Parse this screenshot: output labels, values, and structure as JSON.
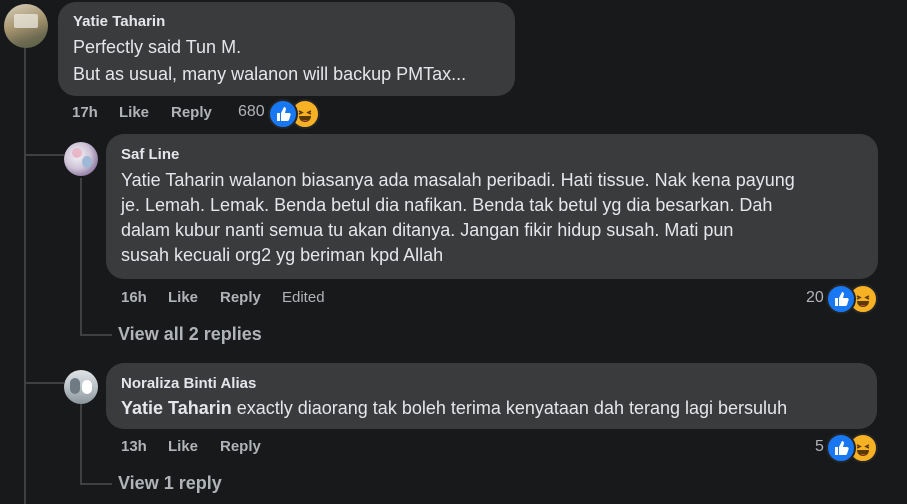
{
  "comments": [
    {
      "author": "Yatie Taharin",
      "lines": [
        "Perfectly said Tun M.",
        "But as usual, many walanon will backup PMTax..."
      ],
      "time": "17h",
      "like": "Like",
      "reply": "Reply",
      "reactions_count": "680",
      "reaction_icons": [
        "like-icon",
        "haha-icon"
      ]
    },
    {
      "author": "Saf Line",
      "lines": [
        "Yatie Taharin walanon biasanya ada masalah peribadi. Hati tissue. Nak kena payung",
        "je. Lemah. Lemak. Benda betul dia nafikan. Benda tak betul yg dia besarkan. Dah",
        "dalam kubur nanti semua tu akan ditanya. Jangan fikir hidup susah. Mati pun",
        "susah kecuali org2 yg beriman kpd Allah"
      ],
      "time": "16h",
      "like": "Like",
      "reply": "Reply",
      "edited": "Edited",
      "reactions_count": "20",
      "view_replies": "View all 2 replies"
    },
    {
      "author": "Noraliza Binti Alias",
      "mention": "Yatie Taharin",
      "text_after_mention": " exactly diaorang tak boleh terima kenyataan dah terang lagi bersuluh",
      "time": "13h",
      "like": "Like",
      "reply": "Reply",
      "reactions_count": "5",
      "view_replies": "View 1 reply"
    }
  ],
  "colors": {
    "background": "#18191a",
    "bubble": "#3a3b3c",
    "text": "#e4e6eb",
    "muted": "#b0b3b8",
    "like_blue": "#1877f2",
    "haha_yellow": "#f7b125"
  }
}
